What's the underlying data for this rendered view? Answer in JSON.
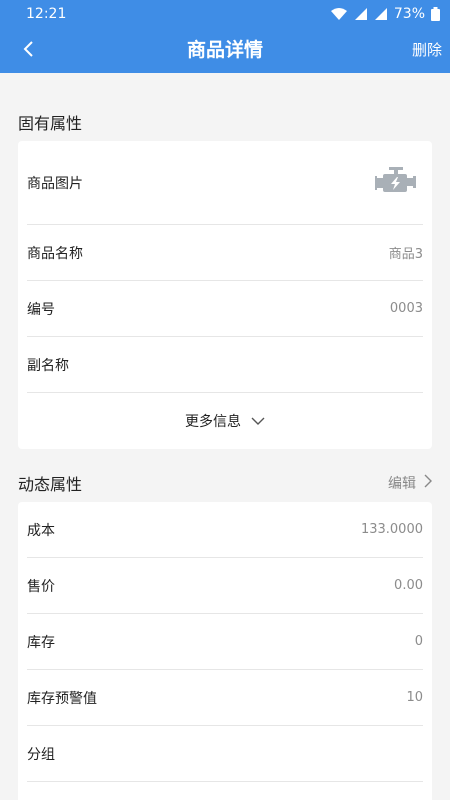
{
  "status_bar": {
    "time": "12:21",
    "battery": "73%"
  },
  "header": {
    "title": "商品详情",
    "action_label": "删除"
  },
  "fixed_section": {
    "title": "固有属性",
    "image_row_label": "商品图片",
    "name_label": "商品名称",
    "name_value": "商品3",
    "code_label": "编号",
    "code_value": "0003",
    "alias_label": "副名称",
    "alias_value": "",
    "more_label": "更多信息"
  },
  "dynamic_section": {
    "title": "动态属性",
    "edit_label": "编辑",
    "rows": [
      {
        "label": "成本",
        "value": "133.0000"
      },
      {
        "label": "售价",
        "value": "0.00"
      },
      {
        "label": "库存",
        "value": "0"
      },
      {
        "label": "库存预警值",
        "value": "10"
      },
      {
        "label": "分组",
        "value": ""
      }
    ]
  },
  "colors": {
    "primary": "#3f8de6",
    "background": "#f4f4f4",
    "muted_text": "#8c8c8c"
  },
  "icons": [
    "back-chevron-icon",
    "wifi-icon",
    "signal-icon",
    "battery-icon",
    "engine-icon",
    "chevron-down-icon",
    "chevron-right-icon"
  ]
}
